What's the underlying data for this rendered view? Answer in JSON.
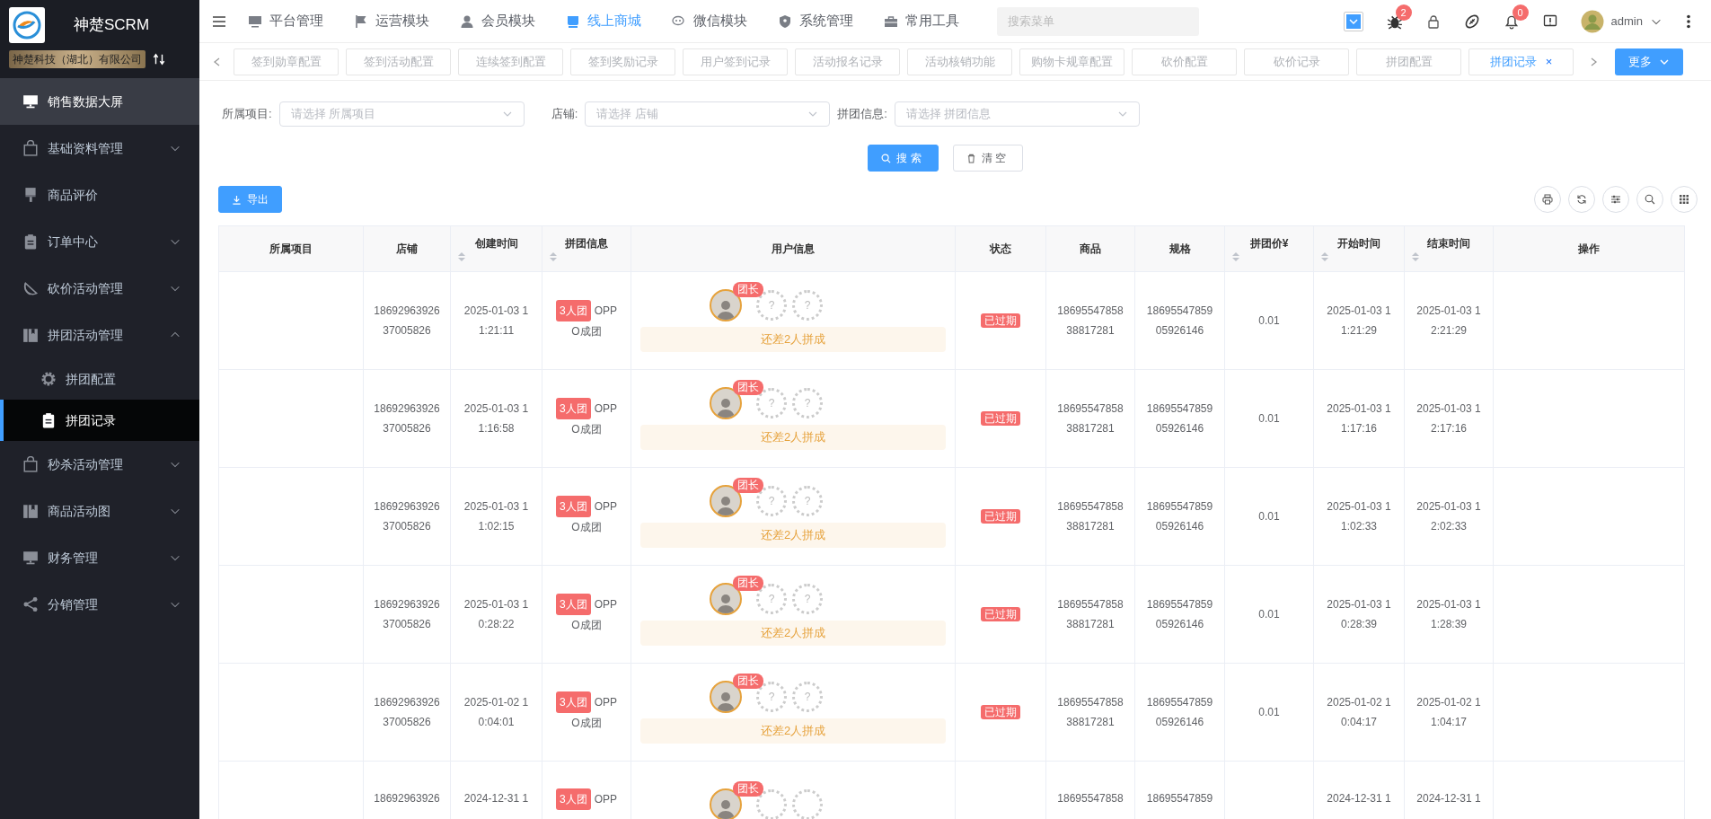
{
  "sidebar": {
    "brand": "神楚SCRM",
    "company": "神楚科技（湖北）有限公司",
    "items": [
      {
        "label": "销售数据大屏",
        "selected": false,
        "highlighted": true
      },
      {
        "label": "基础资料管理",
        "selected": false,
        "expanded": false
      },
      {
        "label": "商品评价",
        "selected": false
      },
      {
        "label": "订单中心",
        "selected": false,
        "expanded": false
      },
      {
        "label": "砍价活动管理",
        "selected": false,
        "expanded": false
      },
      {
        "label": "拼团活动管理",
        "selected": false,
        "expanded": true,
        "children": [
          {
            "label": "拼团配置",
            "selected": false
          },
          {
            "label": "拼团记录",
            "selected": true
          }
        ]
      },
      {
        "label": "秒杀活动管理",
        "selected": false,
        "expanded": false
      },
      {
        "label": "商品活动图",
        "selected": false,
        "expanded": false
      },
      {
        "label": "财务管理",
        "selected": false,
        "expanded": false
      },
      {
        "label": "分销管理",
        "selected": false,
        "expanded": false
      }
    ]
  },
  "topnav": {
    "menus": [
      {
        "label": "平台管理",
        "selected": false
      },
      {
        "label": "运营模块",
        "selected": false
      },
      {
        "label": "会员模块",
        "selected": false
      },
      {
        "label": "线上商城",
        "selected": true
      },
      {
        "label": "微信模块",
        "selected": false
      },
      {
        "label": "系统管理",
        "selected": false
      },
      {
        "label": "常用工具",
        "selected": false
      }
    ],
    "search": {
      "placeholder": "搜索菜单"
    },
    "bug_count": "2",
    "bell_count": "0",
    "user": "admin"
  },
  "tabs": {
    "items": [
      {
        "label": "签到勋章配置",
        "selected": false
      },
      {
        "label": "签到活动配置",
        "selected": false
      },
      {
        "label": "连续签到配置",
        "selected": false
      },
      {
        "label": "签到奖励记录",
        "selected": false
      },
      {
        "label": "用户签到记录",
        "selected": false
      },
      {
        "label": "活动报名记录",
        "selected": false
      },
      {
        "label": "活动核销功能",
        "selected": false
      },
      {
        "label": "购物卡规章配置",
        "selected": false
      },
      {
        "label": "砍价配置",
        "selected": false
      },
      {
        "label": "砍价记录",
        "selected": false
      },
      {
        "label": "拼团配置",
        "selected": false
      },
      {
        "label": "拼团记录",
        "selected": true,
        "close": "×"
      }
    ],
    "more": "更多"
  },
  "filters": [
    {
      "label": "所属项目:",
      "placeholder": "请选择 所属项目"
    },
    {
      "label": "店铺:",
      "placeholder": "请选择 店铺"
    },
    {
      "label": "拼团信息:",
      "placeholder": "请选择 拼团信息"
    }
  ],
  "search_button": "搜索",
  "clear_button": "清空",
  "export_button": "导出",
  "table": {
    "columns": [
      {
        "label": "所属项目",
        "sortable": false
      },
      {
        "label": "店铺",
        "sortable": false
      },
      {
        "label": "创建时间",
        "sortable": true
      },
      {
        "label": "拼团信息",
        "sortable": true
      },
      {
        "label": "用户信息",
        "sortable": false
      },
      {
        "label": "状态",
        "sortable": false
      },
      {
        "label": "商品",
        "sortable": false
      },
      {
        "label": "规格",
        "sortable": false
      },
      {
        "label": "拼团价¥",
        "sortable": true
      },
      {
        "label": "开始时间",
        "sortable": true
      },
      {
        "label": "结束时间",
        "sortable": true
      },
      {
        "label": "操作",
        "sortable": false
      }
    ],
    "rows": [
      {
        "shop": [
          "18692963926",
          "37005826"
        ],
        "created": [
          "2025-01-03 1",
          "1:21:11"
        ],
        "group": {
          "size": "3人团",
          "name": [
            "OPP",
            "O成团"
          ]
        },
        "members": [
          {
            "kind": "leader",
            "tag": "团长"
          },
          {
            "kind": "empty",
            "mark": "?"
          },
          {
            "kind": "empty",
            "mark": "?"
          }
        ],
        "hint": "还差2人拼成",
        "status": "已过期",
        "product": [
          "18695547858",
          "38817281"
        ],
        "spec": [
          "18695547859",
          "05926146"
        ],
        "price": "0.01",
        "start": [
          "2025-01-03 1",
          "1:21:29"
        ],
        "end": [
          "2025-01-03 1",
          "2:21:29"
        ]
      },
      {
        "shop": [
          "18692963926",
          "37005826"
        ],
        "created": [
          "2025-01-03 1",
          "1:16:58"
        ],
        "group": {
          "size": "3人团",
          "name": [
            "OPP",
            "O成团"
          ]
        },
        "members": [
          {
            "kind": "leader",
            "tag": "团长"
          },
          {
            "kind": "empty",
            "mark": "?"
          },
          {
            "kind": "empty",
            "mark": "?"
          }
        ],
        "hint": "还差2人拼成",
        "status": "已过期",
        "product": [
          "18695547858",
          "38817281"
        ],
        "spec": [
          "18695547859",
          "05926146"
        ],
        "price": "0.01",
        "start": [
          "2025-01-03 1",
          "1:17:16"
        ],
        "end": [
          "2025-01-03 1",
          "2:17:16"
        ]
      },
      {
        "shop": [
          "18692963926",
          "37005826"
        ],
        "created": [
          "2025-01-03 1",
          "1:02:15"
        ],
        "group": {
          "size": "3人团",
          "name": [
            "OPP",
            "O成团"
          ]
        },
        "members": [
          {
            "kind": "leader",
            "tag": "团长"
          },
          {
            "kind": "empty",
            "mark": "?"
          },
          {
            "kind": "empty",
            "mark": "?"
          }
        ],
        "hint": "还差2人拼成",
        "status": "已过期",
        "product": [
          "18695547858",
          "38817281"
        ],
        "spec": [
          "18695547859",
          "05926146"
        ],
        "price": "0.01",
        "start": [
          "2025-01-03 1",
          "1:02:33"
        ],
        "end": [
          "2025-01-03 1",
          "2:02:33"
        ]
      },
      {
        "shop": [
          "18692963926",
          "37005826"
        ],
        "created": [
          "2025-01-03 1",
          "0:28:22"
        ],
        "group": {
          "size": "3人团",
          "name": [
            "OPP",
            "O成团"
          ]
        },
        "members": [
          {
            "kind": "leader",
            "tag": "团长"
          },
          {
            "kind": "empty",
            "mark": "?"
          },
          {
            "kind": "empty",
            "mark": "?"
          }
        ],
        "hint": "还差2人拼成",
        "status": "已过期",
        "product": [
          "18695547858",
          "38817281"
        ],
        "spec": [
          "18695547859",
          "05926146"
        ],
        "price": "0.01",
        "start": [
          "2025-01-03 1",
          "0:28:39"
        ],
        "end": [
          "2025-01-03 1",
          "1:28:39"
        ]
      },
      {
        "shop": [
          "18692963926",
          "37005826"
        ],
        "created": [
          "2025-01-02 1",
          "0:04:01"
        ],
        "group": {
          "size": "3人团",
          "name": [
            "OPP",
            "O成团"
          ]
        },
        "members": [
          {
            "kind": "leader",
            "tag": "团长"
          },
          {
            "kind": "empty",
            "mark": "?"
          },
          {
            "kind": "empty",
            "mark": "?"
          }
        ],
        "hint": "还差2人拼成",
        "status": "已过期",
        "product": [
          "18695547858",
          "38817281"
        ],
        "spec": [
          "18695547859",
          "05926146"
        ],
        "price": "0.01",
        "start": [
          "2025-01-02 1",
          "0:04:17"
        ],
        "end": [
          "2025-01-02 1",
          "1:04:17"
        ]
      },
      {
        "shop": [
          "18692963926"
        ],
        "created": [
          "2024-12-31 1"
        ],
        "group": {
          "size": "3人团",
          "name": [
            "OPP"
          ]
        },
        "members": [
          {
            "kind": "leader",
            "tag": "团长"
          },
          {
            "kind": "empty"
          },
          {
            "kind": "empty"
          }
        ],
        "product": [
          "18695547858"
        ],
        "spec": [
          "18695547859"
        ],
        "start": [
          "2024-12-31 1"
        ],
        "end": [
          "2024-12-31 1"
        ]
      }
    ]
  }
}
